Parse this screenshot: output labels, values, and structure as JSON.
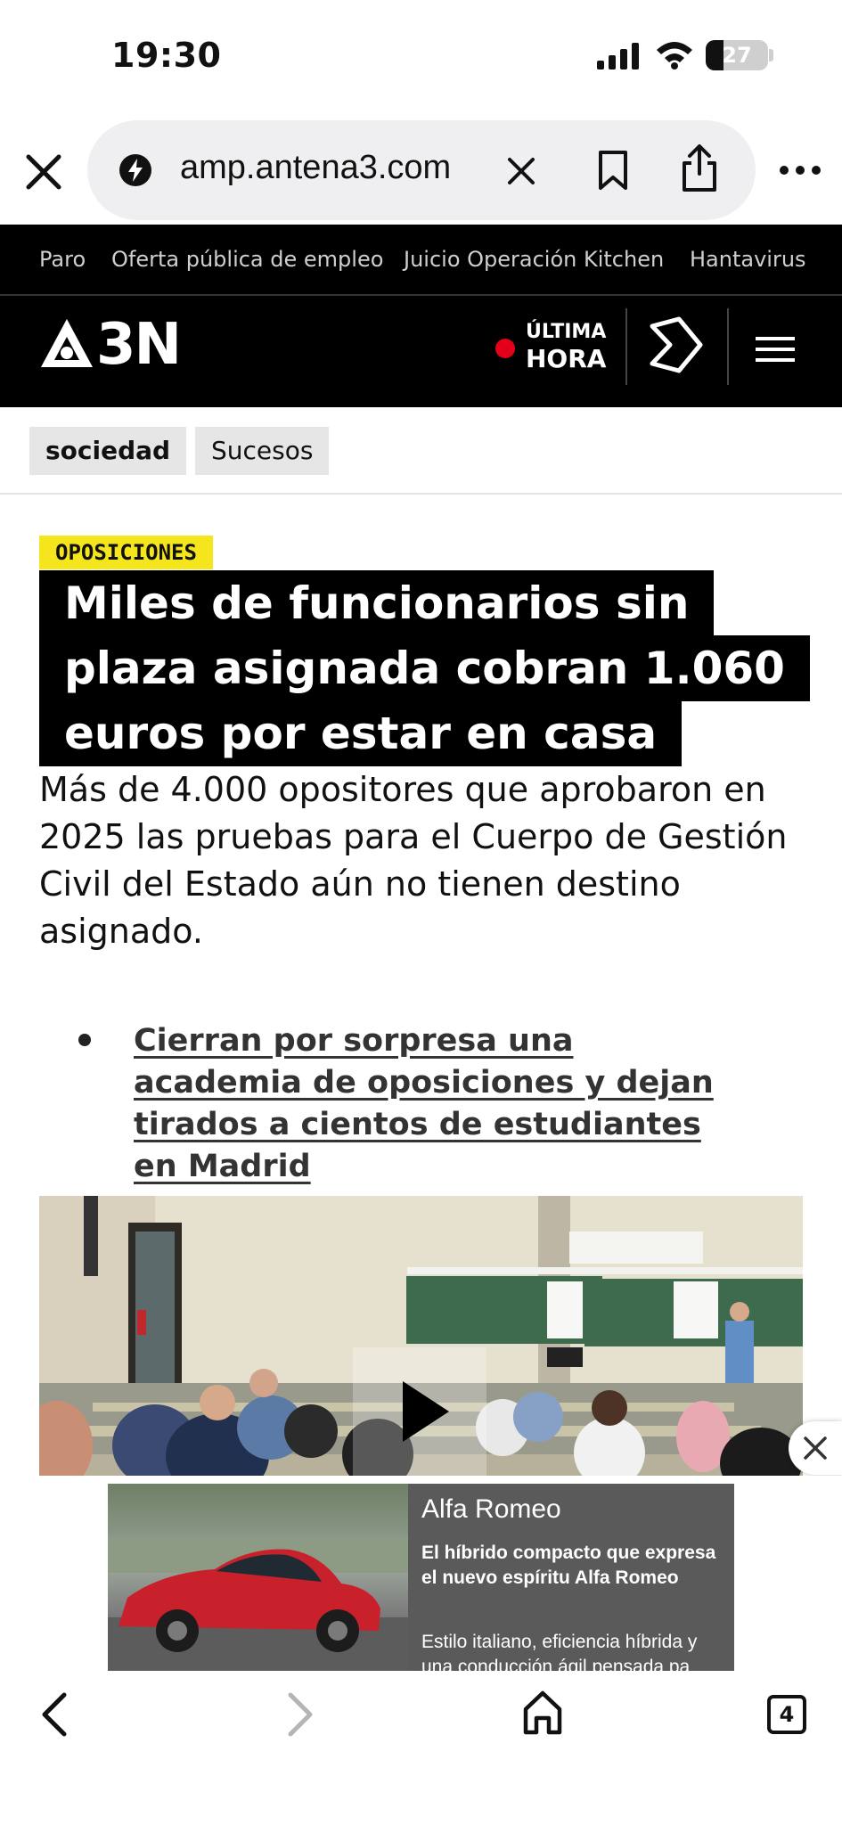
{
  "status_bar": {
    "time": "19:30",
    "battery": "27"
  },
  "browser": {
    "url": "amp.antena3.com"
  },
  "topics": [
    "Paro",
    "Oferta pública de empleo",
    "Juicio Operación Kitchen",
    "Hantavirus"
  ],
  "header": {
    "logo": "3N",
    "live_top": "ÚLTIMA",
    "live_bottom": "HORA"
  },
  "chips": [
    "sociedad",
    "Sucesos"
  ],
  "article": {
    "kicker": "OPOSICIONES",
    "headline_lines": [
      "Miles de funcionarios sin",
      "plaza asignada cobran 1.060",
      "euros por estar en casa"
    ],
    "standfirst": "Más de 4.000 opositores que aprobaron en 2025 las pruebas para el Cuerpo de Gestión Civil del Estado aún no tienen destino asignado.",
    "related_link": "Cierran por sorpresa una academia de oposiciones y dejan tirados a cientos de estudiantes en Madrid"
  },
  "ad": {
    "brand": "Alfa Romeo",
    "headline": "El híbrido compacto que expresa el nuevo espíritu Alfa Romeo",
    "description": "Estilo italiano, eficiencia híbrida y una conducción ágil pensada pa"
  },
  "toolbar": {
    "tab_count": "4"
  },
  "colors": {
    "kicker_bg": "#f5e51c",
    "live_dot": "#e3001b",
    "header_bg": "#000000"
  }
}
